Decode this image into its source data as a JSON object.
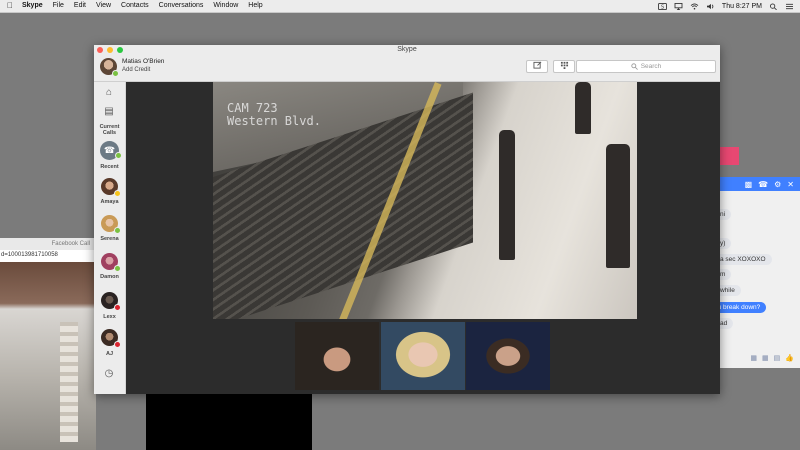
{
  "menubar": {
    "app_name": "Skype",
    "items": [
      "File",
      "Edit",
      "View",
      "Contacts",
      "Conversations",
      "Window",
      "Help"
    ],
    "clock": "Thu 8:27 PM"
  },
  "skype": {
    "window_title": "Skype",
    "profile": {
      "name": "Matias O'Brien",
      "credit_link": "Add Credit"
    },
    "search_placeholder": "Search",
    "sidebar": {
      "current_calls_label": "Current Calls",
      "recent_label": "Recent",
      "contacts": [
        {
          "name": "Amaya",
          "status": "away"
        },
        {
          "name": "Serena",
          "status": "online"
        },
        {
          "name": "Damon",
          "status": "online"
        },
        {
          "name": "Lexx",
          "status": "busy"
        },
        {
          "name": "AJ",
          "status": "busy"
        }
      ]
    },
    "camera_overlay": "CAM 723\nWestern Blvd."
  },
  "facebook_call": {
    "title": "Facebook Call",
    "url_fragment": "d=100013981710058"
  },
  "messenger": {
    "messages": [
      {
        "text": "ni",
        "from_me": false
      },
      {
        "text": "y)",
        "from_me": false
      },
      {
        "text": "a sec XOXOXO",
        "from_me": false
      },
      {
        "text": "m",
        "from_me": false
      },
      {
        "text": "while",
        "from_me": false
      },
      {
        "text": "ou break down?",
        "from_me": true
      },
      {
        "text": "ad",
        "from_me": false
      }
    ]
  },
  "colors": {
    "skype_dark": "#2c2c2c",
    "messenger_blue": "#4080ff",
    "online": "#7ac142",
    "away": "#f6c31b",
    "busy": "#d9232e"
  }
}
